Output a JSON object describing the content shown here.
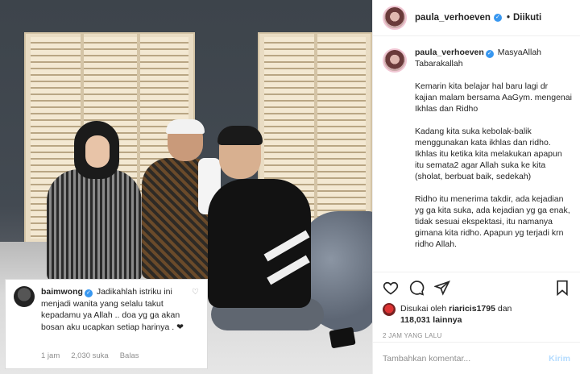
{
  "header": {
    "username": "paula_verhoeven",
    "separator": "•",
    "follow_label": "Diikuti"
  },
  "caption": {
    "username": "paula_verhoeven",
    "first_line": "MasyaAllah Tabarakallah",
    "paragraphs": [
      "Kemarin kita belajar hal baru lagi dr kajian malam bersama AaGym. mengenai Ikhlas dan Ridho",
      "Kadang kita suka kebolak-balik menggunakan kata ikhlas dan ridho. Ikhlas itu ketika kita melakukan apapun itu semata2 agar Allah suka ke kita (sholat, berbuat baik, sedekah)",
      "Ridho itu menerima takdir, ada kejadian yg ga kita suka, ada kejadian yg ga enak, tidak sesuai ekspektasi, itu namanya gimana kita ridho. Apapun yg terjadi krn ridho Allah."
    ]
  },
  "icons": {
    "like": "heart-icon",
    "comment": "comment-icon",
    "share": "share-icon",
    "save": "bookmark-icon"
  },
  "likes": {
    "prefix": "Disukai oleh",
    "user": "riaricis1795",
    "conjunction": "dan",
    "count": "118,031 lainnya"
  },
  "timestamp": "2 JAM YANG LALU",
  "comment_input": {
    "placeholder": "Tambahkan komentar...",
    "post_label": "Kirim"
  },
  "overlay_comment": {
    "username": "baimwong",
    "text": "Jadikahlah istriku ini menjadi wanita yang selalu takut kepadamu ya Allah .. doa yg ga akan bosan aku ucapkan setiap harinya . ❤",
    "time": "1 jam",
    "likes": "2,030 suka",
    "reply": "Balas"
  },
  "colors": {
    "verified": "#3897f0",
    "post_button": "#b3dbff",
    "muted": "#8e8e8e"
  }
}
